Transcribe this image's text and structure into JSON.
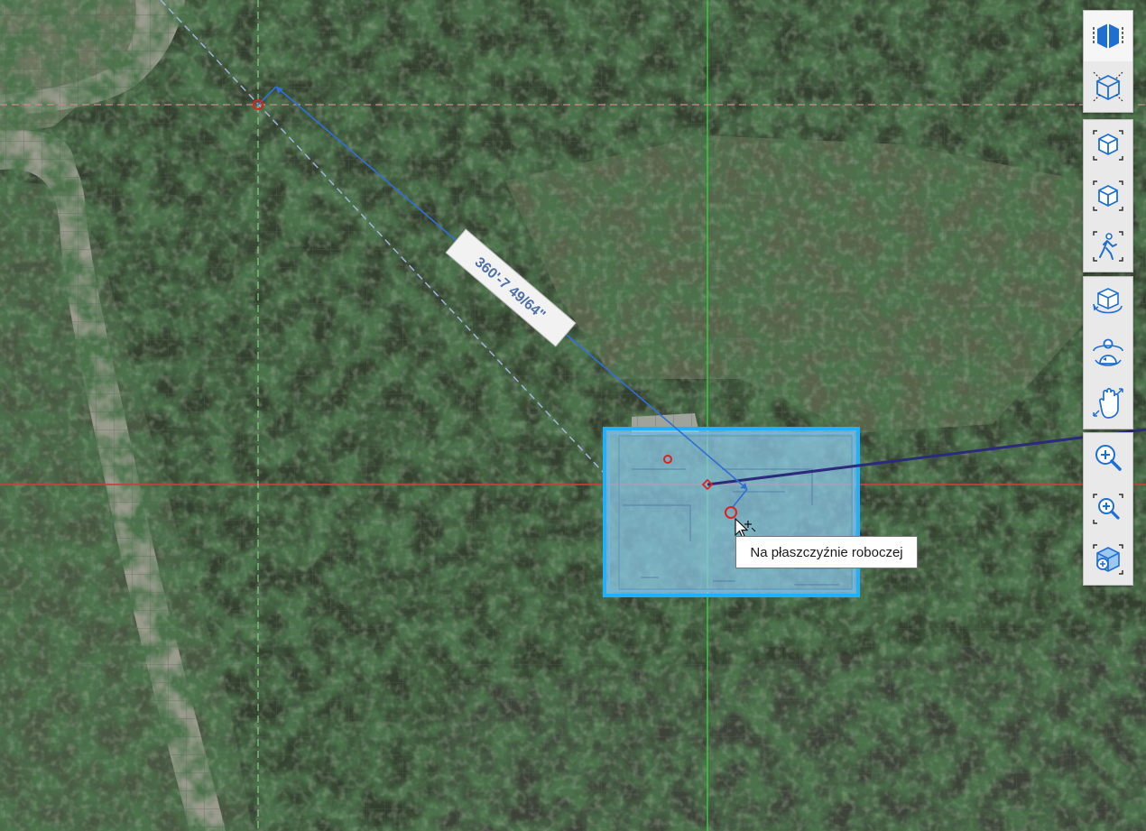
{
  "dimension_label": "360'-7 49/64\"",
  "tooltip": {
    "text": "Na płaszczyźnie roboczej"
  },
  "colors": {
    "grid_line": "#4a554a",
    "axis_green": "#39c93c",
    "axis_red": "#d9393c",
    "guide_pink": "#c98c8c",
    "guide_lightblue": "#9fb3dc",
    "dimension_blue": "#2f6fd6",
    "selection_blue": "#1fb0ff",
    "selection_fill": "#8ccbec",
    "dark_line": "#2c2a7a",
    "marker_red": "#e02020"
  },
  "toolbar": {
    "groups": [
      {
        "name": "view-mode",
        "buttons": [
          {
            "name": "plan-view-button",
            "icon": "plan-view-icon",
            "active": true
          },
          {
            "name": "3d-view-button",
            "icon": "3d-view-icon",
            "active": false
          }
        ]
      },
      {
        "name": "camera-views",
        "buttons": [
          {
            "name": "home-view-button",
            "icon": "home-view-icon",
            "active": false
          },
          {
            "name": "perspective-view-button",
            "icon": "perspective-view-icon",
            "active": false
          },
          {
            "name": "walkthrough-button",
            "icon": "walkthrough-icon",
            "active": false
          }
        ]
      },
      {
        "name": "navigation",
        "buttons": [
          {
            "name": "orbit-button",
            "icon": "orbit-icon",
            "active": false
          },
          {
            "name": "look-around-button",
            "icon": "look-around-icon",
            "active": false
          },
          {
            "name": "pan-button",
            "icon": "pan-hand-icon",
            "active": false
          }
        ]
      },
      {
        "name": "zoom",
        "buttons": [
          {
            "name": "zoom-button",
            "icon": "zoom-icon",
            "active": false
          },
          {
            "name": "zoom-window-button",
            "icon": "zoom-window-icon",
            "active": false
          },
          {
            "name": "zoom-extents-button",
            "icon": "zoom-extents-icon",
            "active": false
          }
        ]
      }
    ]
  }
}
